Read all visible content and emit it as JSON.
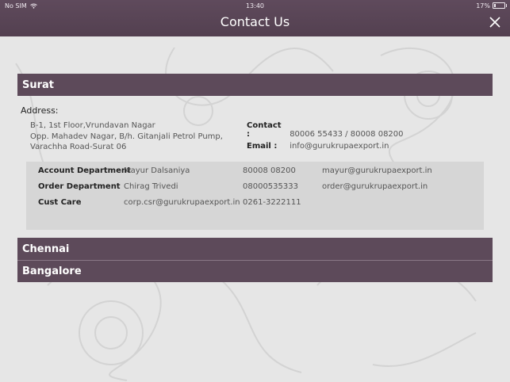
{
  "status_bar": {
    "carrier": "No SIM",
    "time": "13:40",
    "battery_text": "17%",
    "battery_level": 0.17,
    "wifi_icon": "wifi-icon"
  },
  "header": {
    "title": "Contact Us",
    "close_icon": "close-icon"
  },
  "sections": [
    {
      "city": "Surat",
      "expanded": true,
      "address_label": "Address:",
      "address_lines": [
        "B-1, 1st Floor,Vrundavan Nagar",
        "Opp. Mahadev Nagar, B/h. Gitanjali Petrol Pump,",
        "Varachha Road-Surat 06"
      ],
      "contact_label": "Contact :",
      "contact_value": "80006 55433 / 80008 08200",
      "email_label": "Email :",
      "email_value": "info@gurukrupaexport.in",
      "departments": [
        {
          "name": "Account Department",
          "person": "Mayur Dalsaniya",
          "phone": "80008 08200",
          "email": "mayur@gurukrupaexport.in"
        },
        {
          "name": "Order Department",
          "person": "Chirag Trivedi",
          "phone": "08000535333",
          "email": "order@gurukrupaexport.in"
        },
        {
          "name": "Cust Care",
          "person": "corp.csr@gurukrupaexport.in",
          "phone": "0261-3222111",
          "email": ""
        }
      ]
    },
    {
      "city": "Chennai",
      "expanded": false
    },
    {
      "city": "Bangalore",
      "expanded": false
    }
  ],
  "colors": {
    "header_bg": "#5d4a5a",
    "page_bg": "#e6e6e6",
    "table_bg": "#d6d6d6"
  }
}
